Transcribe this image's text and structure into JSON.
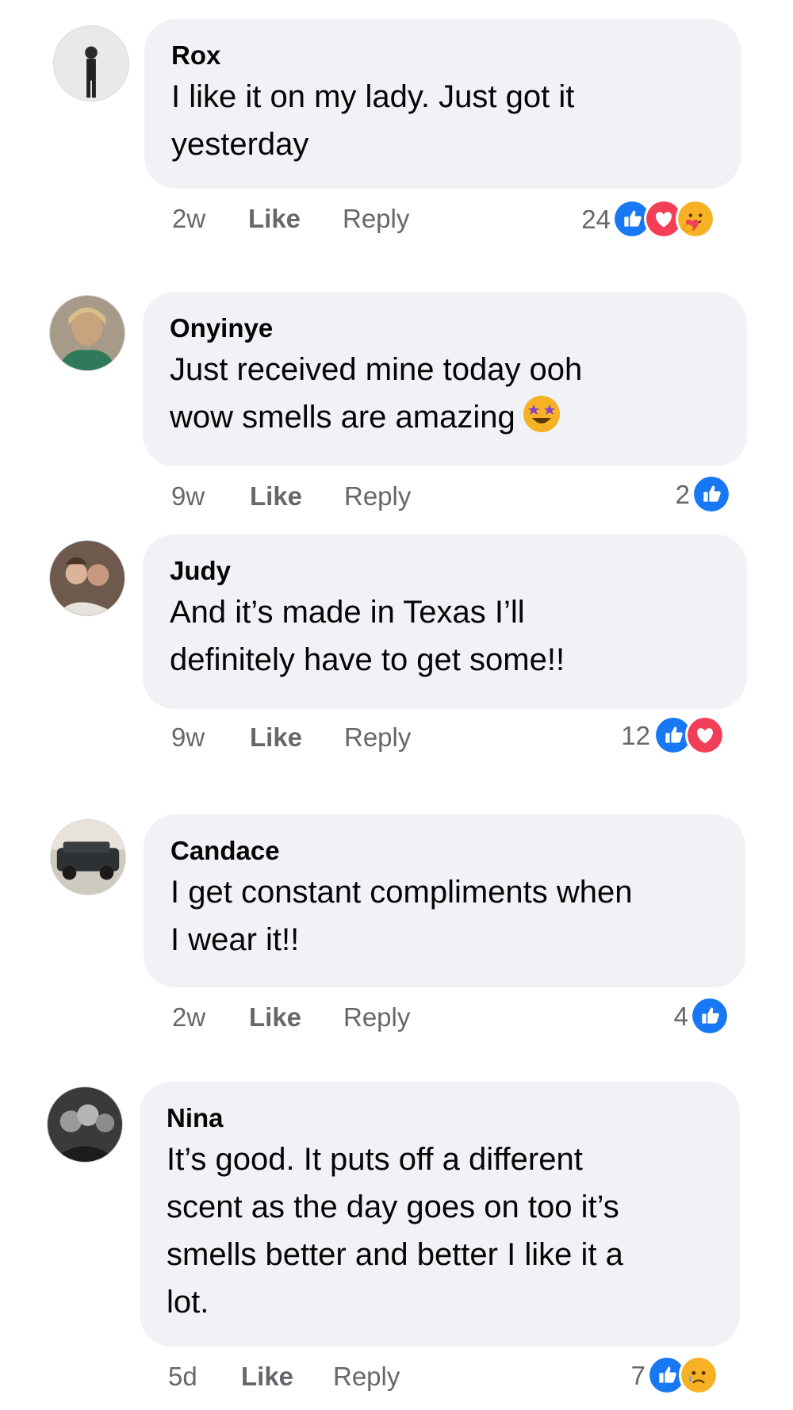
{
  "comments": [
    {
      "author": "Rox",
      "text": "I like it on my lady. Just got it\nyesterday",
      "time": "2w",
      "like_label": "Like",
      "reply_label": "Reply",
      "reaction_count": "24",
      "reactions": [
        "like-icon",
        "love-icon",
        "care-icon"
      ]
    },
    {
      "author": "Onyinye",
      "text": "Just received mine today ooh\nwow smells are amazing",
      "emoji": "star-struck-emoji",
      "time": "9w",
      "like_label": "Like",
      "reply_label": "Reply",
      "reaction_count": "2",
      "reactions": [
        "like-icon"
      ]
    },
    {
      "author": "Judy",
      "text": "And it’s made in Texas I’ll\ndefinitely have to get some!!",
      "time": "9w",
      "like_label": "Like",
      "reply_label": "Reply",
      "reaction_count": "12",
      "reactions": [
        "like-icon",
        "love-icon"
      ]
    },
    {
      "author": "Candace",
      "text": "I get constant compliments when\nI wear it!!",
      "time": "2w",
      "like_label": "Like",
      "reply_label": "Reply",
      "reaction_count": "4",
      "reactions": [
        "like-icon"
      ]
    },
    {
      "author": "Nina",
      "text": "It’s good. It puts off a different\nscent as the day goes on too it’s\nsmells better and better I like it a\nlot.",
      "time": "5d",
      "like_label": "Like",
      "reply_label": "Reply",
      "reaction_count": "7",
      "reactions": [
        "like-icon",
        "sad-icon"
      ]
    }
  ],
  "colors": {
    "bubble": "#f0f2f5",
    "meta_text": "#65676b",
    "like_blue": "#1877f2",
    "love_red": "#f33e58",
    "emoji_yellow": "#f7b125"
  }
}
